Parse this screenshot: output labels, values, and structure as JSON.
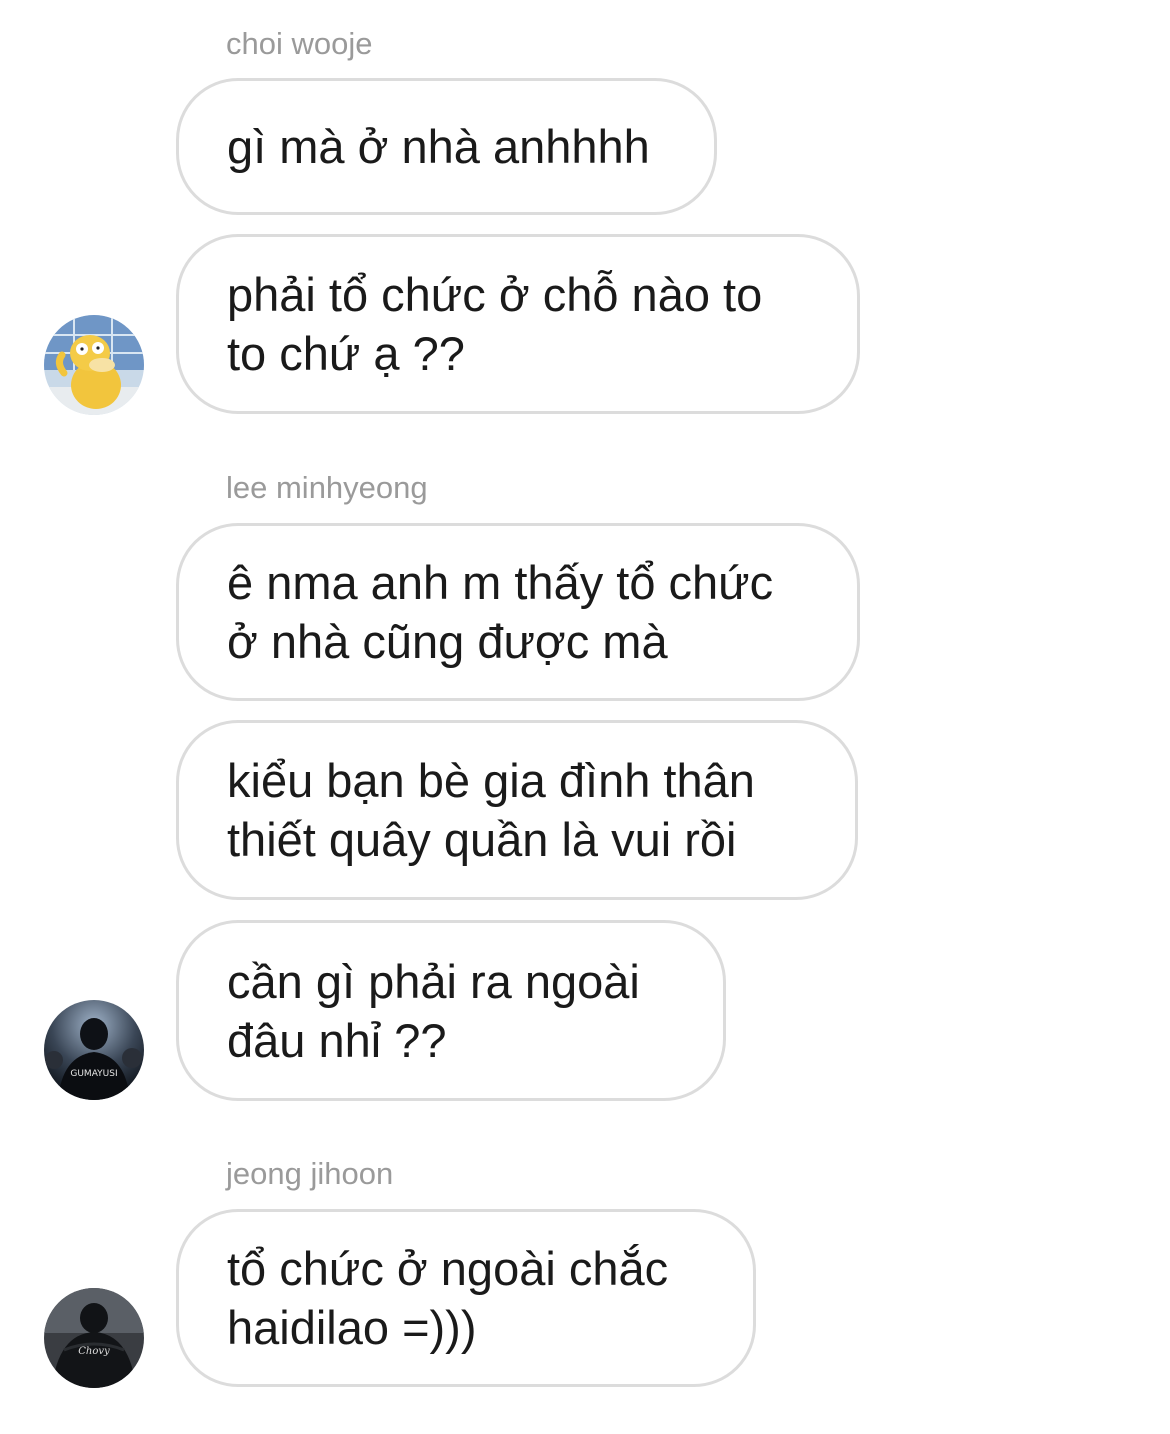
{
  "thread": {
    "groups": [
      {
        "sender": "choi wooje",
        "avatar_icon": "psyduck-avatar",
        "messages": [
          {
            "lines": [
              "gì mà ở nhà anhhhh"
            ]
          },
          {
            "lines": [
              "phải tổ chức ở chỗ nào to",
              "to chứ ạ ??"
            ]
          }
        ]
      },
      {
        "sender": "lee minhyeong",
        "avatar_icon": "player-back-photo-avatar",
        "avatar_text": "GUMAYUSI",
        "messages": [
          {
            "lines": [
              "ê nma anh m thấy tổ chức",
              "ở nhà cũng được mà"
            ]
          },
          {
            "lines": [
              "kiểu bạn bè gia đình thân",
              "thiết quây quần là vui rồi"
            ]
          },
          {
            "lines": [
              "cần gì phải ra ngoài",
              "đâu nhỉ ??"
            ]
          }
        ]
      },
      {
        "sender": "jeong jihoon",
        "avatar_icon": "player-back-photo-avatar",
        "avatar_text": "Chovy",
        "messages": [
          {
            "lines": [
              "tổ chức ở ngoài chắc",
              "haidilao =)))"
            ]
          }
        ]
      }
    ]
  },
  "colors": {
    "background": "#ffffff",
    "bubble_border": "#dcdcdc",
    "sender_name": "#9a9a9a",
    "message_text": "#1a1a1a"
  }
}
